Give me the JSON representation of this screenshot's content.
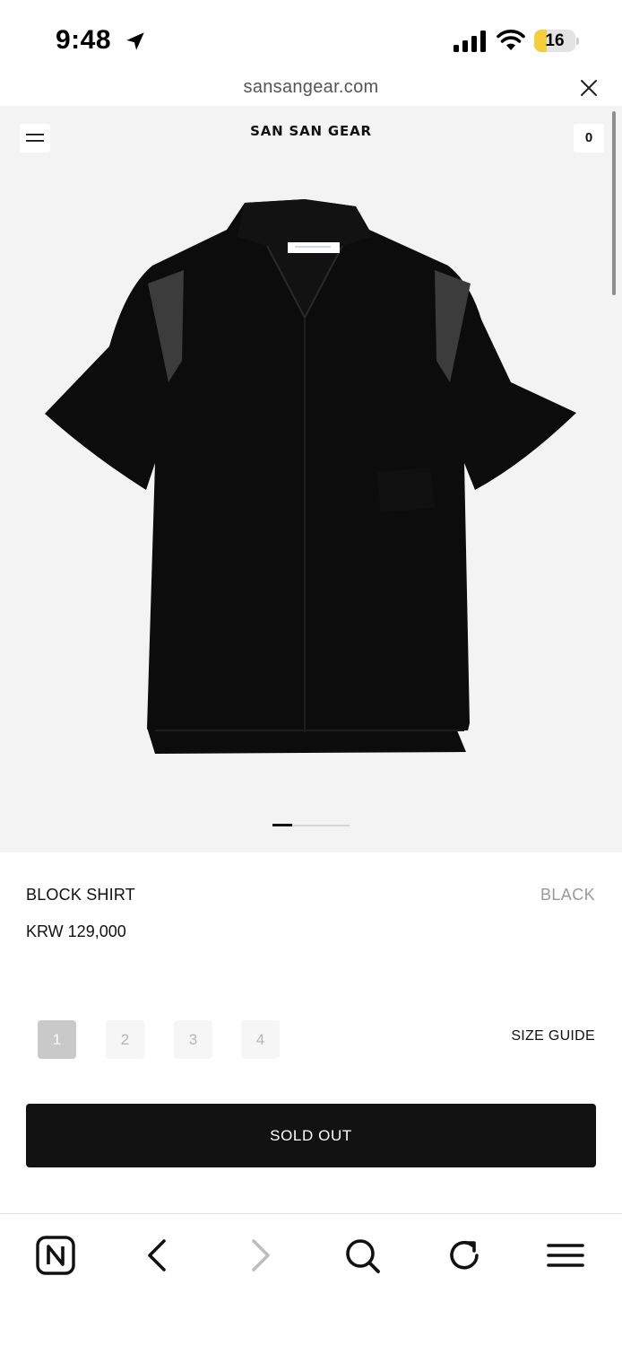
{
  "status_bar": {
    "time": "9:48",
    "battery": "16",
    "battery_level_percent": 16
  },
  "browser": {
    "url": "sansangear.com"
  },
  "site": {
    "brand": "SAN SAN GEAR",
    "cart_count": "0"
  },
  "product": {
    "name": "BLOCK SHIRT",
    "color": "BLACK",
    "price": "KRW 129,000",
    "image_pager": {
      "current": 1,
      "total": 4
    },
    "sizes": [
      {
        "label": "1",
        "selected": true
      },
      {
        "label": "2",
        "selected": false
      },
      {
        "label": "3",
        "selected": false
      },
      {
        "label": "4",
        "selected": false
      }
    ],
    "size_guide_label": "SIZE GUIDE",
    "cta_label": "SOLD OUT"
  },
  "toolbar": {
    "icons": [
      "naver-app-icon",
      "back-icon",
      "forward-icon",
      "search-icon",
      "refresh-icon",
      "menu-icon"
    ]
  },
  "colors": {
    "cta_background": "#121212",
    "hero_background": "#f3f3f3",
    "selected_size": "#c9c9c9",
    "battery_fill": "#f5cf3a"
  }
}
